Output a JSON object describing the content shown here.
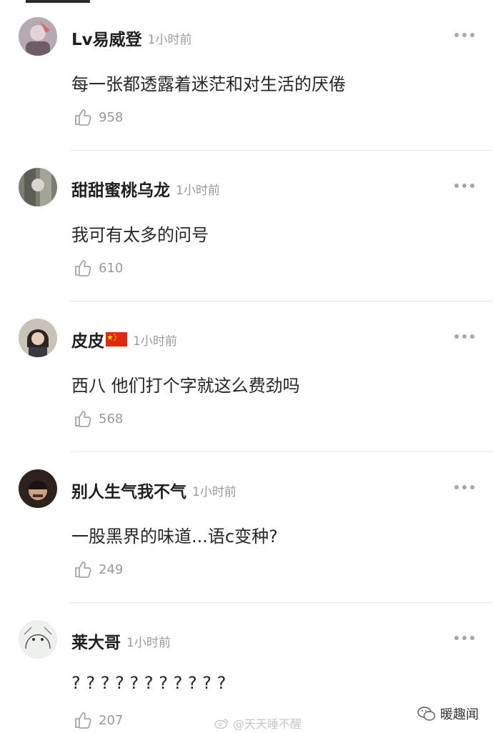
{
  "comments": [
    {
      "username": "Lv易威登",
      "time": "1小时前",
      "content": "每一张都透露着迷茫和对生活的厌倦",
      "likes": "958",
      "flag": false,
      "avatar_color": "#8e7b86"
    },
    {
      "username": "甜甜蜜桃乌龙",
      "time": "1小时前",
      "content": "我可有太多的问号",
      "likes": "610",
      "flag": false,
      "avatar_color": "#6f7268"
    },
    {
      "username": "皮皮",
      "time": "1小时前",
      "content": "西八 他们打个字就这么费劲吗",
      "likes": "568",
      "flag": true,
      "avatar_color": "#5b4a3f"
    },
    {
      "username": "别人生气我不气",
      "time": "1小时前",
      "content": "一股黑界的味道...语c变种?",
      "likes": "249",
      "flag": false,
      "avatar_color": "#4a3a30"
    },
    {
      "username": "莱大哥",
      "time": "1小时前",
      "content": "? ? ? ? ? ? ? ? ? ? ?",
      "likes": "207",
      "flag": false,
      "avatar_color": "#e9ece9"
    }
  ],
  "watermarks": {
    "center": "@天天睡不醒",
    "right": "暖趣闻"
  }
}
